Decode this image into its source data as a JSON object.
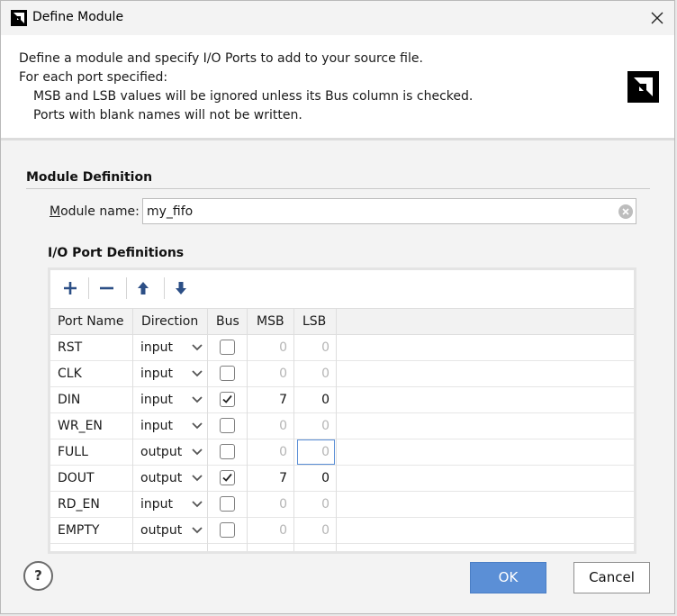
{
  "window": {
    "title": "Define Module"
  },
  "header": {
    "line1": "Define a module and specify I/O Ports to add to your source file.",
    "line2": "For each port specified:",
    "line3": "MSB and LSB values will be ignored unless its Bus column is checked.",
    "line4": "Ports with blank names will not be written."
  },
  "module_definition": {
    "section_title": "Module Definition",
    "name_label_accel": "M",
    "name_label_rest": "odule name:",
    "name_value": "my_fifo"
  },
  "io_ports": {
    "section_title": "I/O Port Definitions",
    "toolbar": [
      "add-icon",
      "remove-icon",
      "move-up-icon",
      "move-down-icon"
    ],
    "columns": [
      "Port Name",
      "Direction",
      "Bus",
      "MSB",
      "LSB"
    ],
    "rows": [
      {
        "name": "RST",
        "direction": "input",
        "bus": false,
        "msb": "0",
        "lsb": "0"
      },
      {
        "name": "CLK",
        "direction": "input",
        "bus": false,
        "msb": "0",
        "lsb": "0"
      },
      {
        "name": "DIN",
        "direction": "input",
        "bus": true,
        "msb": "7",
        "lsb": "0"
      },
      {
        "name": "WR_EN",
        "direction": "input",
        "bus": false,
        "msb": "0",
        "lsb": "0"
      },
      {
        "name": "FULL",
        "direction": "output",
        "bus": false,
        "msb": "0",
        "lsb": "0"
      },
      {
        "name": "DOUT",
        "direction": "output",
        "bus": true,
        "msb": "7",
        "lsb": "0"
      },
      {
        "name": "RD_EN",
        "direction": "input",
        "bus": false,
        "msb": "0",
        "lsb": "0"
      },
      {
        "name": "EMPTY",
        "direction": "output",
        "bus": false,
        "msb": "0",
        "lsb": "0"
      }
    ],
    "focused_row_index": 4
  },
  "buttons": {
    "help": "?",
    "ok": "OK",
    "cancel": "Cancel"
  },
  "colors": {
    "accent": "#5b8fd6",
    "panel": "#f3f3f3",
    "header_bg": "#ffffff"
  }
}
